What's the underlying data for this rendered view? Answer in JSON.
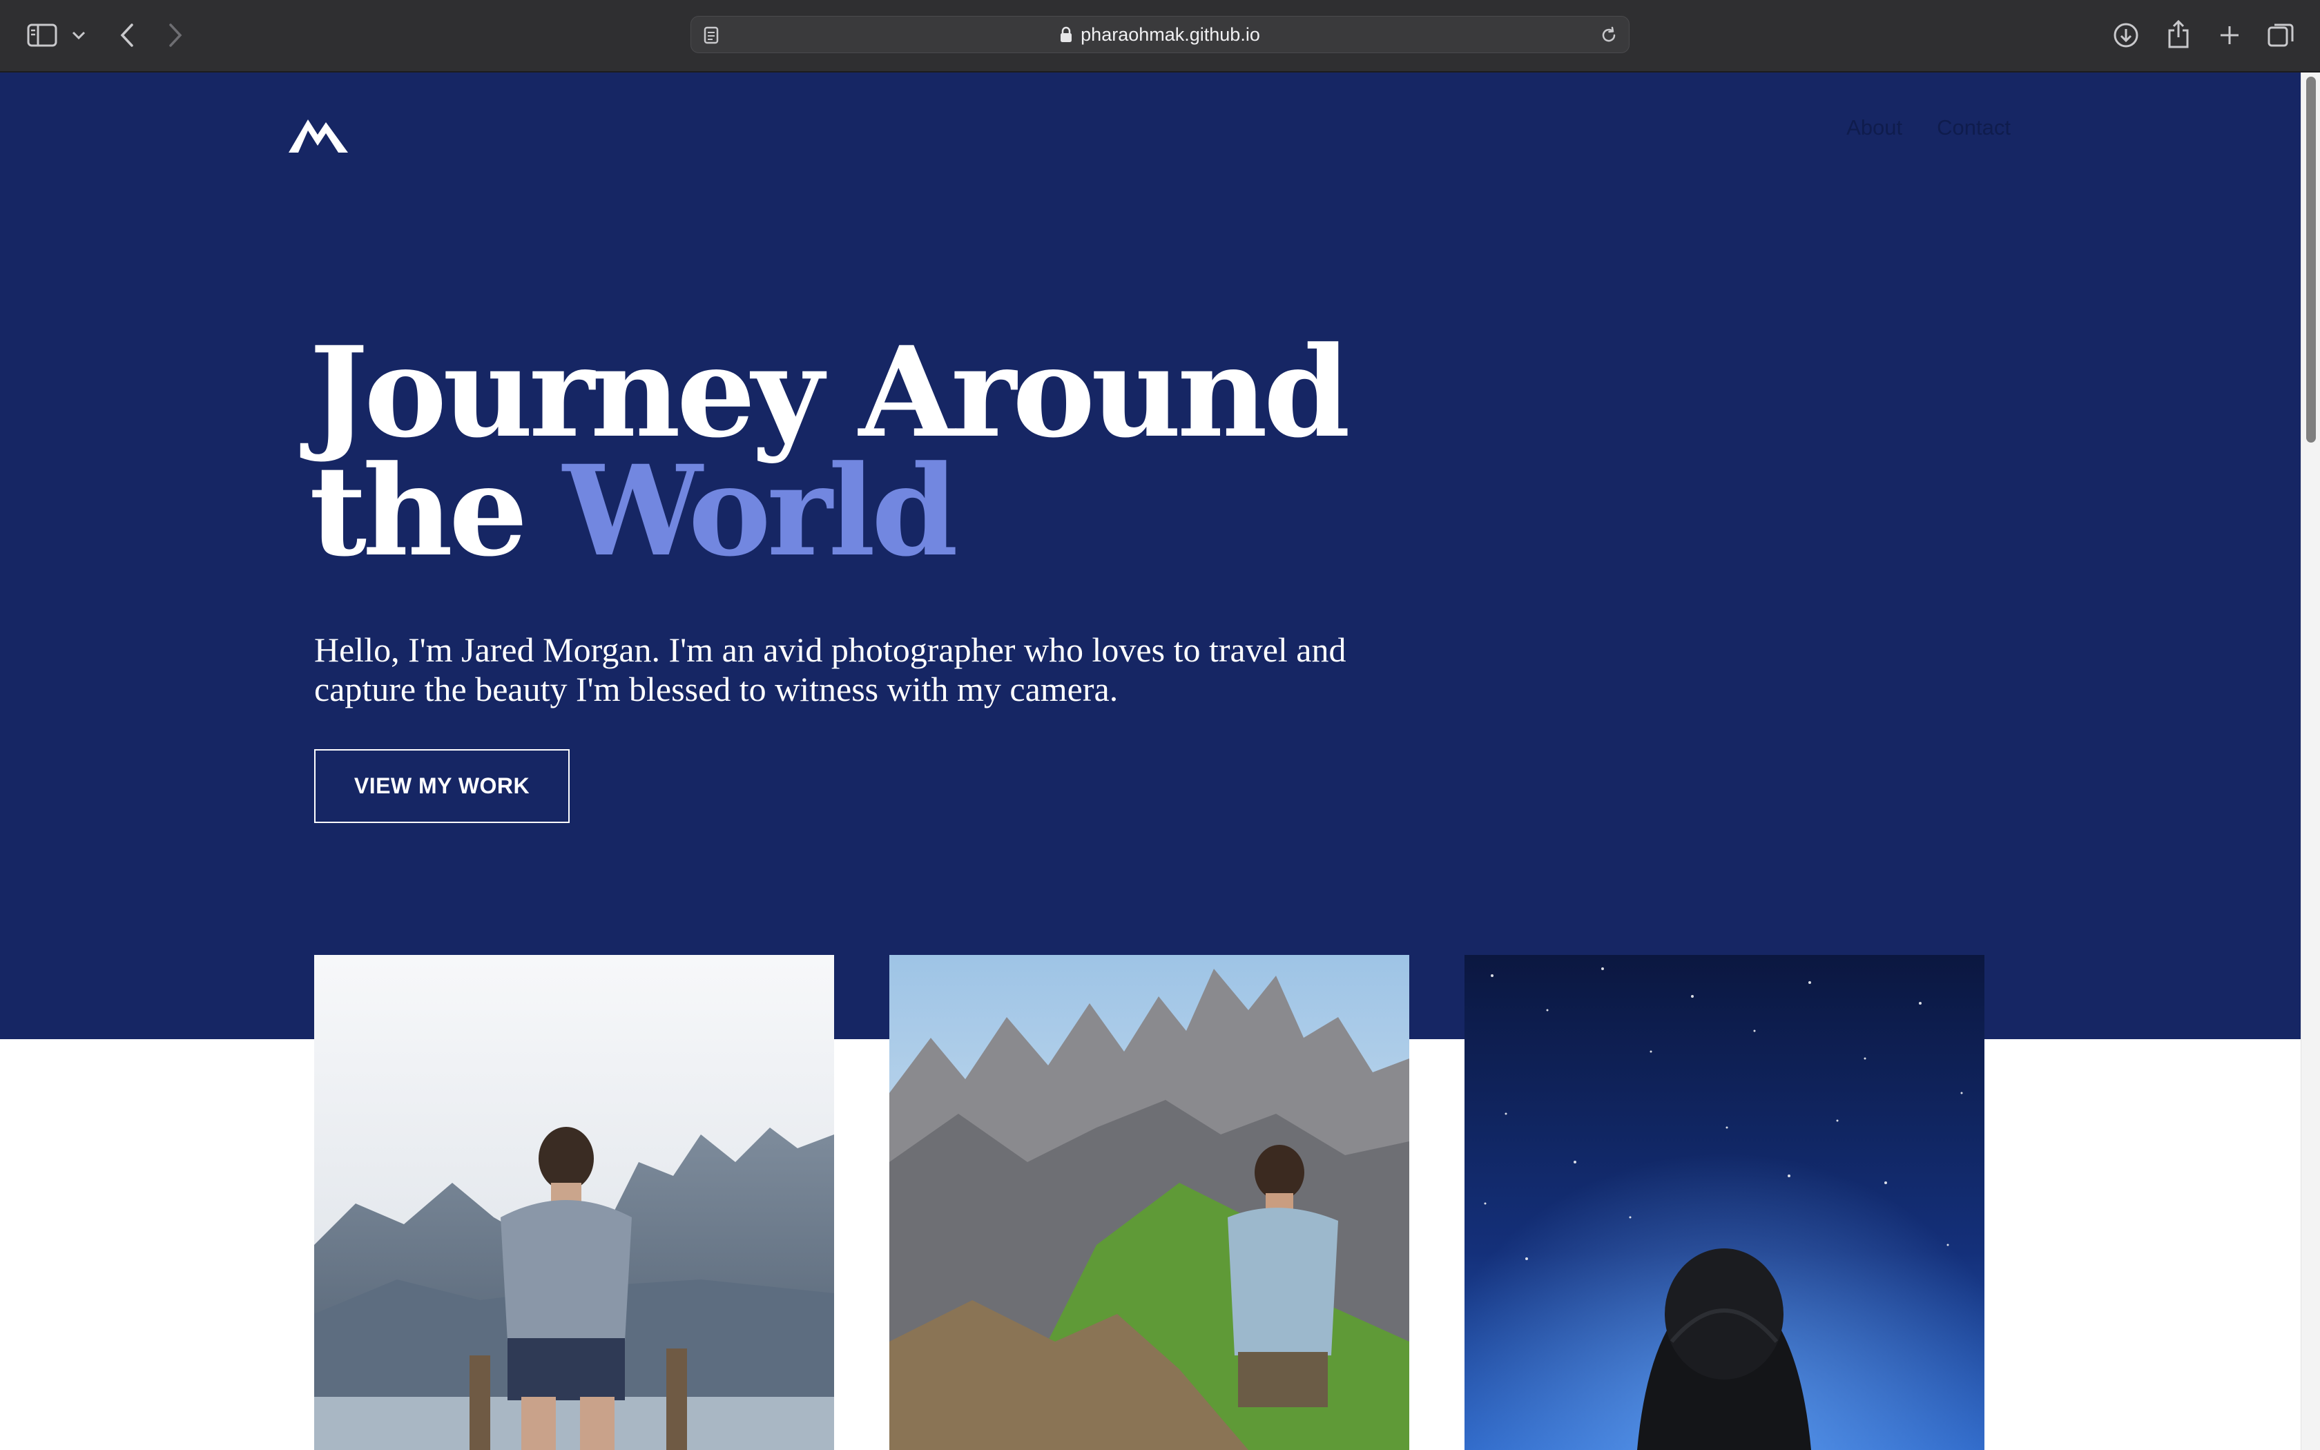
{
  "browser": {
    "url": "pharaohmak.github.io",
    "icons": [
      "sidebar-icon",
      "chevron-down-icon",
      "back-arrow-icon",
      "forward-arrow-icon",
      "reader-icon",
      "lock-icon",
      "reload-icon",
      "download-icon",
      "share-icon",
      "plus-icon",
      "tabs-icon"
    ]
  },
  "site": {
    "logo": "mountain-logo",
    "nav": {
      "about": "About",
      "contact": "Contact"
    },
    "hero": {
      "title_line1": "Journey Around",
      "title_line2_part1": "the",
      "title_line2_accent": "World",
      "intro": "Hello, I'm Jared Morgan. I'm an avid photographer who loves to travel and capture the beauty I'm blessed to witness with my camera.",
      "cta": "VIEW MY WORK"
    },
    "gallery": [
      {
        "subject": "man on dock looking at lake and mountains"
      },
      {
        "subject": "man on green ridge facing rocky peaks"
      },
      {
        "subject": "person in hooded jacket under starry night sky"
      }
    ]
  },
  "colors": {
    "hero_bg": "#162664",
    "accent": "#7287e0",
    "text": "#ffffff",
    "chrome_bg": "#2f2f31"
  }
}
